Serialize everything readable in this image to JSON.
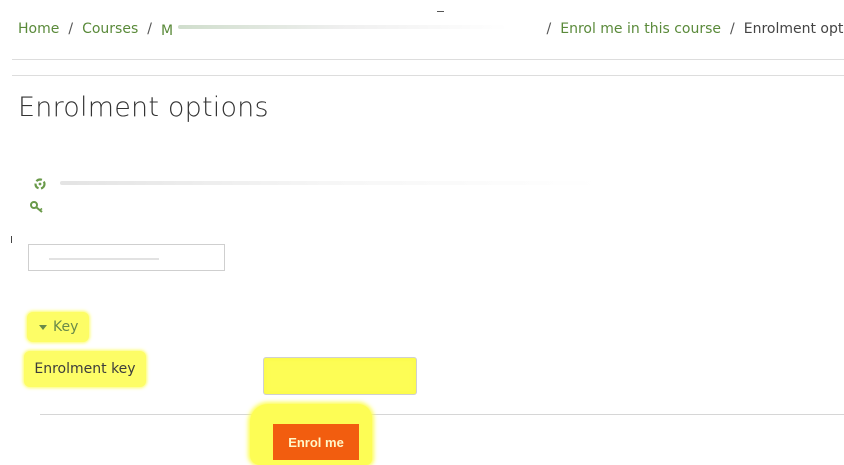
{
  "breadcrumb": {
    "home": "Home",
    "courses": "Courses",
    "course_prefix": "M",
    "enrol_link": "Enrol me in this course",
    "current": "Enrolment options",
    "separator": "/"
  },
  "page_title": "Enrolment options",
  "icons": {
    "course_icon": "recycle-icon",
    "key_icon": "key-icon"
  },
  "key_section": {
    "label": "Key",
    "expanded": true
  },
  "enrolment_key": {
    "label": "Enrolment key",
    "value": ""
  },
  "enrol_button": {
    "label": "Enrol me"
  },
  "colors": {
    "link": "#5a8a3a",
    "highlight": "#fdfd66",
    "button": "#f25d0f"
  }
}
